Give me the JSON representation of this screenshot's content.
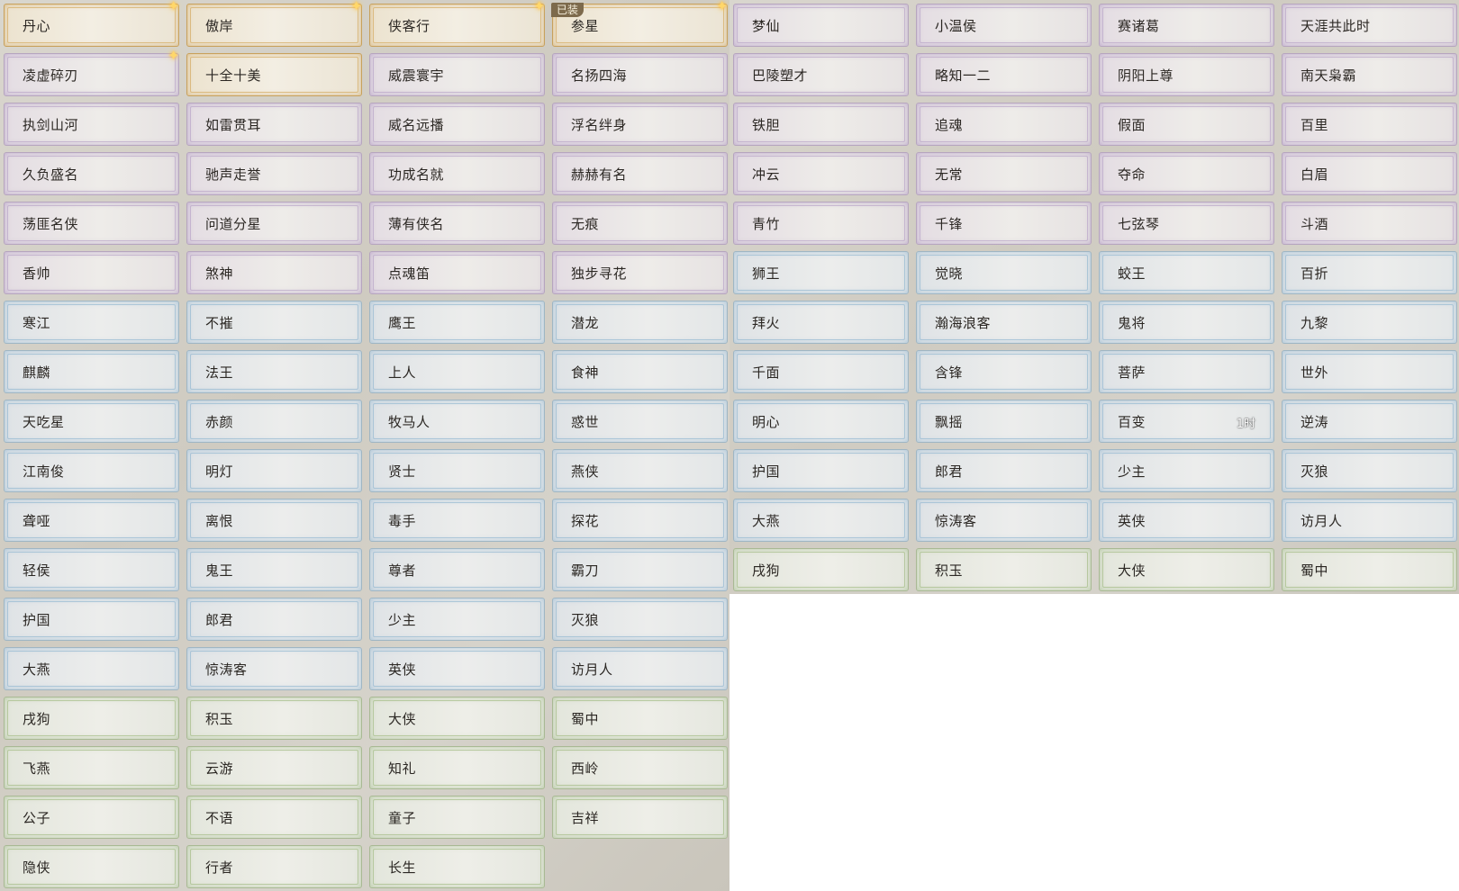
{
  "left_panel": [
    {
      "label": "丹心",
      "rarity": "gold",
      "star": true
    },
    {
      "label": "傲岸",
      "rarity": "gold",
      "star": true
    },
    {
      "label": "侠客行",
      "rarity": "gold",
      "star": true
    },
    {
      "label": "参星",
      "rarity": "gold",
      "star": true,
      "badge": "已装"
    },
    {
      "label": "凌虚碎刃",
      "rarity": "purple",
      "star": true
    },
    {
      "label": "十全十美",
      "rarity": "gold"
    },
    {
      "label": "威震寰宇",
      "rarity": "purple"
    },
    {
      "label": "名扬四海",
      "rarity": "purple"
    },
    {
      "label": "执剑山河",
      "rarity": "purple"
    },
    {
      "label": "如雷贯耳",
      "rarity": "purple"
    },
    {
      "label": "威名远播",
      "rarity": "purple"
    },
    {
      "label": "浮名绊身",
      "rarity": "purple"
    },
    {
      "label": "久负盛名",
      "rarity": "purple"
    },
    {
      "label": "驰声走誉",
      "rarity": "purple"
    },
    {
      "label": "功成名就",
      "rarity": "purple"
    },
    {
      "label": "赫赫有名",
      "rarity": "purple"
    },
    {
      "label": "荡匪名侠",
      "rarity": "purple"
    },
    {
      "label": "问道分星",
      "rarity": "purple"
    },
    {
      "label": "薄有侠名",
      "rarity": "purple"
    },
    {
      "label": "无痕",
      "rarity": "purple"
    },
    {
      "label": "香帅",
      "rarity": "purple"
    },
    {
      "label": "煞神",
      "rarity": "purple"
    },
    {
      "label": "点魂笛",
      "rarity": "purple"
    },
    {
      "label": "独步寻花",
      "rarity": "purple"
    },
    {
      "label": "寒江",
      "rarity": "blue"
    },
    {
      "label": "不摧",
      "rarity": "blue"
    },
    {
      "label": "鹰王",
      "rarity": "blue"
    },
    {
      "label": "潜龙",
      "rarity": "blue"
    },
    {
      "label": "麒麟",
      "rarity": "blue"
    },
    {
      "label": "法王",
      "rarity": "blue"
    },
    {
      "label": "上人",
      "rarity": "blue"
    },
    {
      "label": "食神",
      "rarity": "blue"
    },
    {
      "label": "天吃星",
      "rarity": "blue"
    },
    {
      "label": "赤颜",
      "rarity": "blue"
    },
    {
      "label": "牧马人",
      "rarity": "blue"
    },
    {
      "label": "惑世",
      "rarity": "blue"
    },
    {
      "label": "江南俊",
      "rarity": "blue"
    },
    {
      "label": "明灯",
      "rarity": "blue"
    },
    {
      "label": "贤士",
      "rarity": "blue"
    },
    {
      "label": "燕侠",
      "rarity": "blue"
    },
    {
      "label": "聋哑",
      "rarity": "blue"
    },
    {
      "label": "离恨",
      "rarity": "blue"
    },
    {
      "label": "毒手",
      "rarity": "blue"
    },
    {
      "label": "探花",
      "rarity": "blue"
    },
    {
      "label": "轻侯",
      "rarity": "blue"
    },
    {
      "label": "鬼王",
      "rarity": "blue"
    },
    {
      "label": "尊者",
      "rarity": "blue"
    },
    {
      "label": "霸刀",
      "rarity": "blue"
    },
    {
      "label": "护国",
      "rarity": "blue"
    },
    {
      "label": "郎君",
      "rarity": "blue"
    },
    {
      "label": "少主",
      "rarity": "blue"
    },
    {
      "label": "灭狼",
      "rarity": "blue"
    },
    {
      "label": "大燕",
      "rarity": "blue"
    },
    {
      "label": "惊涛客",
      "rarity": "blue"
    },
    {
      "label": "英侠",
      "rarity": "blue"
    },
    {
      "label": "访月人",
      "rarity": "blue"
    },
    {
      "label": "戌狗",
      "rarity": "green"
    },
    {
      "label": "积玉",
      "rarity": "green"
    },
    {
      "label": "大侠",
      "rarity": "green"
    },
    {
      "label": "蜀中",
      "rarity": "green"
    },
    {
      "label": "飞燕",
      "rarity": "green"
    },
    {
      "label": "云游",
      "rarity": "green"
    },
    {
      "label": "知礼",
      "rarity": "green"
    },
    {
      "label": "西岭",
      "rarity": "green"
    },
    {
      "label": "公子",
      "rarity": "green"
    },
    {
      "label": "不语",
      "rarity": "green"
    },
    {
      "label": "童子",
      "rarity": "green"
    },
    {
      "label": "吉祥",
      "rarity": "green"
    },
    {
      "label": "隐侠",
      "rarity": "green"
    },
    {
      "label": "行者",
      "rarity": "green"
    },
    {
      "label": "长生",
      "rarity": "green"
    }
  ],
  "right_panel": [
    {
      "label": "梦仙",
      "rarity": "purple"
    },
    {
      "label": "小温侯",
      "rarity": "purple"
    },
    {
      "label": "赛诸葛",
      "rarity": "purple"
    },
    {
      "label": "天涯共此时",
      "rarity": "purple"
    },
    {
      "label": "巴陵塑才",
      "rarity": "purple"
    },
    {
      "label": "略知一二",
      "rarity": "purple"
    },
    {
      "label": "阴阳上尊",
      "rarity": "purple"
    },
    {
      "label": "南天枭霸",
      "rarity": "purple"
    },
    {
      "label": "铁胆",
      "rarity": "purple"
    },
    {
      "label": "追魂",
      "rarity": "purple"
    },
    {
      "label": "假面",
      "rarity": "purple"
    },
    {
      "label": "百里",
      "rarity": "purple"
    },
    {
      "label": "冲云",
      "rarity": "purple"
    },
    {
      "label": "无常",
      "rarity": "purple"
    },
    {
      "label": "夺命",
      "rarity": "purple"
    },
    {
      "label": "白眉",
      "rarity": "purple"
    },
    {
      "label": "青竹",
      "rarity": "purple"
    },
    {
      "label": "千锋",
      "rarity": "purple"
    },
    {
      "label": "七弦琴",
      "rarity": "purple"
    },
    {
      "label": "斗酒",
      "rarity": "purple"
    },
    {
      "label": "狮王",
      "rarity": "blue"
    },
    {
      "label": "觉晓",
      "rarity": "blue"
    },
    {
      "label": "蛟王",
      "rarity": "blue"
    },
    {
      "label": "百折",
      "rarity": "blue"
    },
    {
      "label": "拜火",
      "rarity": "blue"
    },
    {
      "label": "瀚海浪客",
      "rarity": "blue"
    },
    {
      "label": "鬼将",
      "rarity": "blue"
    },
    {
      "label": "九黎",
      "rarity": "blue"
    },
    {
      "label": "千面",
      "rarity": "blue"
    },
    {
      "label": "含锋",
      "rarity": "blue"
    },
    {
      "label": "菩萨",
      "rarity": "blue"
    },
    {
      "label": "世外",
      "rarity": "blue"
    },
    {
      "label": "明心",
      "rarity": "blue"
    },
    {
      "label": "飘摇",
      "rarity": "blue"
    },
    {
      "label": "百变",
      "rarity": "blue",
      "timer": "1时"
    },
    {
      "label": "逆涛",
      "rarity": "blue"
    },
    {
      "label": "护国",
      "rarity": "blue"
    },
    {
      "label": "郎君",
      "rarity": "blue"
    },
    {
      "label": "少主",
      "rarity": "blue"
    },
    {
      "label": "灭狼",
      "rarity": "blue"
    },
    {
      "label": "大燕",
      "rarity": "blue"
    },
    {
      "label": "惊涛客",
      "rarity": "blue"
    },
    {
      "label": "英侠",
      "rarity": "blue"
    },
    {
      "label": "访月人",
      "rarity": "blue"
    },
    {
      "label": "戌狗",
      "rarity": "green"
    },
    {
      "label": "积玉",
      "rarity": "green"
    },
    {
      "label": "大侠",
      "rarity": "green"
    },
    {
      "label": "蜀中",
      "rarity": "green"
    }
  ],
  "icons": {
    "star": "sparkle-star-icon"
  }
}
